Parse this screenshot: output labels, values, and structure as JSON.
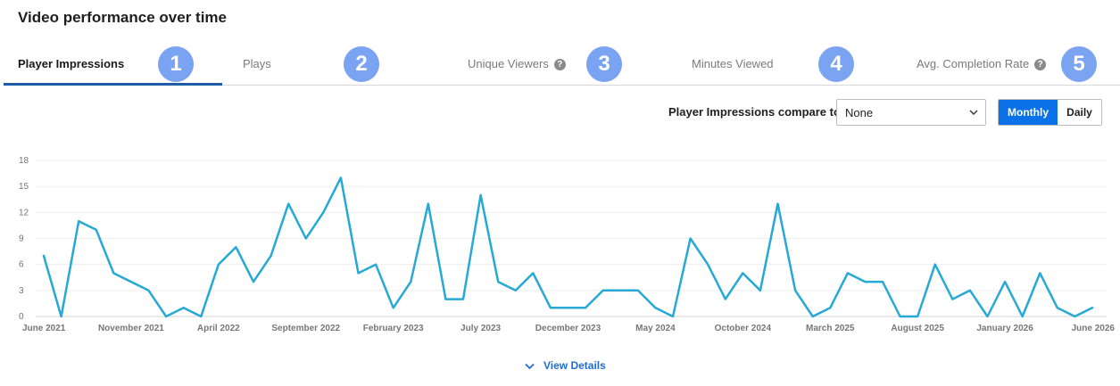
{
  "title": "Video performance over time",
  "tabs": [
    {
      "label": "Player Impressions",
      "badge": "1",
      "active": true,
      "help": false
    },
    {
      "label": "Plays",
      "badge": "2",
      "active": false,
      "help": false
    },
    {
      "label": "Unique Viewers",
      "badge": "3",
      "active": false,
      "help": true
    },
    {
      "label": "Minutes Viewed",
      "badge": "4",
      "active": false,
      "help": false
    },
    {
      "label": "Avg. Completion Rate",
      "badge": "5",
      "active": false,
      "help": true
    }
  ],
  "help_glyph": "?",
  "compare": {
    "label": "Player Impressions compare to",
    "selected": "None"
  },
  "granularity": {
    "monthly": "Monthly",
    "daily": "Daily",
    "selected": "Monthly"
  },
  "view_details": "View Details",
  "colors": {
    "line": "#27a9d6",
    "accent": "#0a71e8",
    "badge": "#7aa4f2",
    "active_tab": "#1f5ca8"
  },
  "chart_data": {
    "type": "line",
    "title": "",
    "xlabel": "",
    "ylabel": "",
    "ylim": [
      0,
      18
    ],
    "yticks": [
      0,
      3,
      6,
      9,
      12,
      15,
      18
    ],
    "grid": true,
    "x_tick_labels": [
      {
        "i": 0,
        "label": "June 2021"
      },
      {
        "i": 5,
        "label": "November 2021"
      },
      {
        "i": 10,
        "label": "April 2022"
      },
      {
        "i": 15,
        "label": "September 2022"
      },
      {
        "i": 20,
        "label": "February 2023"
      },
      {
        "i": 25,
        "label": "July 2023"
      },
      {
        "i": 30,
        "label": "December 2023"
      },
      {
        "i": 35,
        "label": "May 2024"
      },
      {
        "i": 40,
        "label": "October 2024"
      },
      {
        "i": 45,
        "label": "March 2025"
      },
      {
        "i": 50,
        "label": "August 2025"
      },
      {
        "i": 55,
        "label": "January 2026"
      },
      {
        "i": 60,
        "label": "June 2026"
      }
    ],
    "series": [
      {
        "values": [
          7,
          0,
          11,
          10,
          5,
          4,
          3,
          0,
          1,
          0,
          6,
          8,
          4,
          7,
          13,
          9,
          12,
          16,
          5,
          6,
          1,
          4,
          13,
          2,
          2,
          14,
          4,
          3,
          5,
          1,
          1,
          1,
          3,
          3,
          3,
          1,
          0,
          9,
          6,
          2,
          5,
          3,
          13,
          3,
          0,
          1,
          5,
          4,
          4,
          0,
          0,
          6,
          2,
          3,
          0,
          4,
          0,
          5,
          1,
          0,
          1
        ]
      }
    ]
  }
}
